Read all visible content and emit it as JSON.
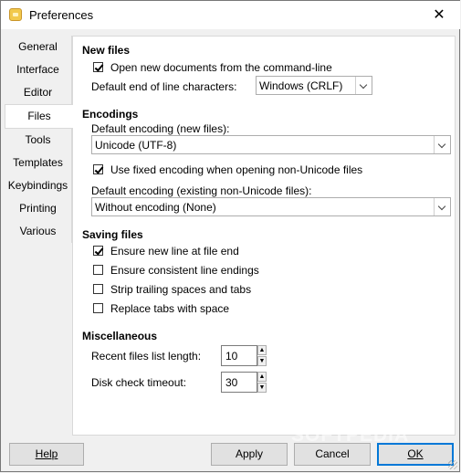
{
  "window": {
    "title": "Preferences",
    "close_glyph": "✕"
  },
  "tabs": [
    {
      "label": "General"
    },
    {
      "label": "Interface"
    },
    {
      "label": "Editor"
    },
    {
      "label": "Files",
      "active": true
    },
    {
      "label": "Tools"
    },
    {
      "label": "Templates"
    },
    {
      "label": "Keybindings"
    },
    {
      "label": "Printing"
    },
    {
      "label": "Various"
    }
  ],
  "new_files": {
    "title": "New files",
    "open_from_cmdline": {
      "label": "Open new documents from the command-line",
      "checked": true
    },
    "eol_label": "Default end of line characters:",
    "eol_value": "Windows (CRLF)"
  },
  "encodings": {
    "title": "Encodings",
    "default_new_label": "Default encoding (new files):",
    "default_new_value": "Unicode (UTF-8)",
    "fixed_encoding": {
      "label": "Use fixed encoding when opening non-Unicode files",
      "checked": true
    },
    "default_existing_label": "Default encoding (existing non-Unicode files):",
    "default_existing_value": "Without encoding (None)"
  },
  "saving": {
    "title": "Saving files",
    "options": [
      {
        "label": "Ensure new line at file end",
        "checked": true
      },
      {
        "label": "Ensure consistent line endings",
        "checked": false
      },
      {
        "label": "Strip trailing spaces and tabs",
        "checked": false
      },
      {
        "label": "Replace tabs with space",
        "checked": false
      }
    ]
  },
  "misc": {
    "title": "Miscellaneous",
    "recent_label": "Recent files list length:",
    "recent_value": "10",
    "disk_label": "Disk check timeout:",
    "disk_value": "30"
  },
  "buttons": {
    "help": "Help",
    "apply": "Apply",
    "cancel": "Cancel",
    "ok": "OK"
  },
  "watermark": "SOFTPEDIA"
}
